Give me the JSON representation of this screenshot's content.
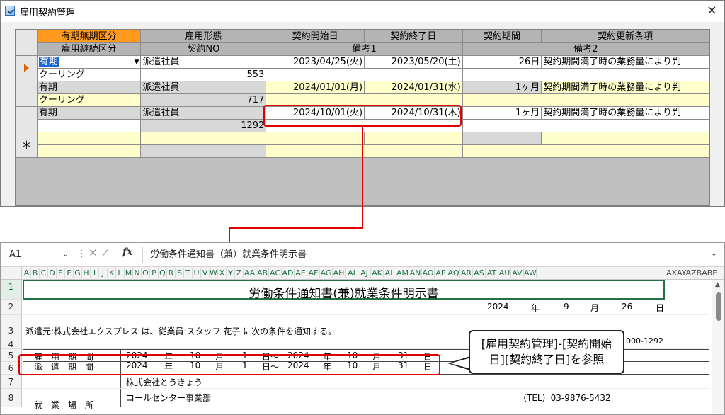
{
  "top_window": {
    "title": "雇用契約管理",
    "close_glyph": "×",
    "headers_row1": [
      "有期無期区分",
      "雇用形態",
      "契約開始日",
      "契約終了日",
      "契約期間",
      "契約更新条項"
    ],
    "headers_row2": [
      "雇用継続区分",
      "契約NO",
      "備考1",
      "備考2"
    ],
    "new_row_marker": "＊",
    "records": [
      {
        "kubun": "有期",
        "keitai": "派遣社員",
        "start": "2023/04/25(火)",
        "end": "2023/05/20(土)",
        "period": "26日",
        "koushin": "契約期間満了時の業務量により判",
        "keizoku": "クーリング",
        "no": "553"
      },
      {
        "kubun": "有期",
        "keitai": "派遣社員",
        "start": "2024/01/01(月)",
        "end": "2024/01/31(水)",
        "period": "1ヶ月",
        "koushin": "契約期間満了時の業務量により判",
        "keizoku": "クーリング",
        "no": "717"
      },
      {
        "kubun": "有期",
        "keitai": "派遣社員",
        "start": "2024/10/01(火)",
        "end": "2024/10/31(木)",
        "period": "1ヶ月",
        "koushin": "契約期間満了時の業務量により判",
        "keizoku": "",
        "no": "1292"
      }
    ],
    "colors": {
      "header_highlight": "#ff9a1e",
      "selection": "#1c66d4",
      "row_yellow": "#ffffcc",
      "annotation_red": "#e00000"
    }
  },
  "excel": {
    "name_box": "A1",
    "fx_label": "fx",
    "formula": "労働条件通知書（兼）就業条件明示書",
    "col_letters": [
      "A",
      "B",
      "C",
      "D",
      "E",
      "F",
      "G",
      "H",
      "I",
      "J",
      "K",
      "L",
      "M",
      "N",
      "O",
      "P",
      "Q",
      "R",
      "S",
      "T",
      "U",
      "V",
      "W",
      "X",
      "Y",
      "Z",
      "AA",
      "AB",
      "AC",
      "AD",
      "AE",
      "AF",
      "AG",
      "AH",
      "AI",
      "AJ",
      "AK",
      "AL",
      "AM",
      "AN",
      "AO",
      "AP",
      "AQ",
      "AR",
      "AS",
      "AT",
      "AU",
      "AV",
      "AW"
    ],
    "col_tail": "AXAYAZBABE",
    "row_numbers": [
      "1",
      "2",
      "3",
      "4",
      "5",
      "6",
      "7",
      "8"
    ],
    "doc_title": "労働条件通知書(兼)就業条件明示書",
    "issue_date": {
      "year": "2024",
      "nen": "年",
      "month": "9",
      "tsuki": "月",
      "day": "26",
      "hi": "日"
    },
    "notice_line": "派遣元:株式会社エクスプレス は、従業員:スタッフ 花子 に次の条件を通知する。",
    "contract_no_partial": "000-1292",
    "koyou_label": "雇　用　期　間",
    "haken_label": "派　遣　期　間",
    "period": {
      "y1": "2024",
      "nen1": "年",
      "m1": "10",
      "tsuki1": "月",
      "d1": "1",
      "hi_kara": "日～",
      "y2": "2024",
      "nen2": "年",
      "m2": "10",
      "tsuki2": "月",
      "d2": "31",
      "hi2": "日"
    },
    "company": "株式会社とうきょう",
    "department": "コールセンター事業部",
    "tel": "（TEL）03-9876-5432",
    "workplace_label": "就　業　場　所"
  },
  "callout": {
    "line1": "[雇用契約管理]-[契約開始",
    "line2": "日][契約終了日]を参照"
  }
}
